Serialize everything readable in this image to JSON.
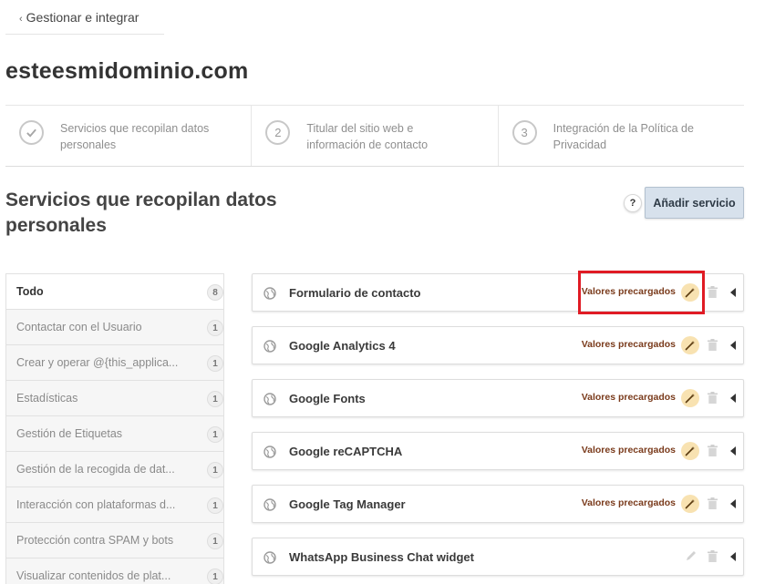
{
  "nav": {
    "back_chevron": "‹",
    "back_label": "Gestionar e integrar"
  },
  "domain": "esteesmidominio.com",
  "steps": [
    {
      "number": "",
      "icon": "check-icon",
      "label": "Servicios que recopilan datos personales"
    },
    {
      "number": "2",
      "label": "Titular del sitio web e información de contacto"
    },
    {
      "number": "3",
      "label": "Integración de la Política de Privacidad"
    }
  ],
  "section": {
    "title": "Servicios que recopilan datos personales"
  },
  "actions": {
    "help_label": "?",
    "add_label": "Añadir servicio"
  },
  "categories": [
    {
      "label": "Todo",
      "count": "8",
      "active": true
    },
    {
      "label": "Contactar con el Usuario",
      "count": "1"
    },
    {
      "label": "Crear y operar @{this_applica...",
      "count": "1"
    },
    {
      "label": "Estadísticas",
      "count": "1"
    },
    {
      "label": "Gestión de Etiquetas",
      "count": "1"
    },
    {
      "label": "Gestión de la recogida de dat...",
      "count": "1"
    },
    {
      "label": "Interacción con plataformas d...",
      "count": "1"
    },
    {
      "label": "Protección contra SPAM y bots",
      "count": "1"
    },
    {
      "label": "Visualizar contenidos de plat...",
      "count": "1"
    }
  ],
  "services": [
    {
      "name": "Formulario de contacto",
      "preset_label": "Valores precargados",
      "preset": true
    },
    {
      "name": "Google Analytics 4",
      "preset_label": "Valores precargados",
      "preset": true
    },
    {
      "name": "Google Fonts",
      "preset_label": "Valores precargados",
      "preset": true
    },
    {
      "name": "Google reCAPTCHA",
      "preset_label": "Valores precargados",
      "preset": true
    },
    {
      "name": "Google Tag Manager",
      "preset_label": "Valores precargados",
      "preset": true
    },
    {
      "name": "WhatsApp Business Chat widget",
      "preset_label": "",
      "preset": false
    }
  ],
  "colors": {
    "accent": "#d7e1ec",
    "preset_text": "#7a3b1c",
    "wand_bg": "#f8e2b1",
    "highlight": "#e01b24"
  }
}
